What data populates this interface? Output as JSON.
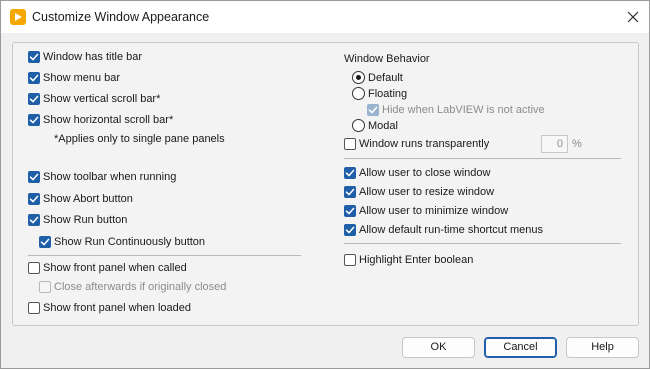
{
  "window": {
    "title": "Customize Window Appearance"
  },
  "left": {
    "title_bar": {
      "label": "Window has title bar",
      "checked": true
    },
    "menu_bar": {
      "label": "Show menu bar",
      "checked": true
    },
    "vscroll": {
      "label": "Show vertical scroll bar*",
      "checked": true
    },
    "hscroll": {
      "label": "Show horizontal scroll bar*",
      "checked": true
    },
    "note": "*Applies only to single pane panels",
    "toolbar": {
      "label": "Show toolbar when running",
      "checked": true
    },
    "abort": {
      "label": "Show Abort button",
      "checked": true
    },
    "run": {
      "label": "Show Run button",
      "checked": true
    },
    "run_cont": {
      "label": "Show Run Continuously button",
      "checked": true
    },
    "fp_called": {
      "label": "Show front panel when called",
      "checked": false
    },
    "close_after": {
      "label": "Close afterwards if originally closed",
      "checked": false
    },
    "fp_loaded": {
      "label": "Show front panel when loaded",
      "checked": false
    }
  },
  "right": {
    "behavior_label": "Window Behavior",
    "default": {
      "label": "Default",
      "selected": true
    },
    "floating": {
      "label": "Floating",
      "selected": false
    },
    "hide_active": {
      "label": "Hide when LabVIEW is not active",
      "checked": true
    },
    "modal": {
      "label": "Modal",
      "selected": false
    },
    "transparent": {
      "label": "Window runs transparently",
      "checked": false
    },
    "transparency_value": "0",
    "transparency_unit": "%",
    "allow_close": {
      "label": "Allow user to close window",
      "checked": true
    },
    "allow_resize": {
      "label": "Allow user to resize window",
      "checked": true
    },
    "allow_minimize": {
      "label": "Allow user to minimize window",
      "checked": true
    },
    "allow_shortcut": {
      "label": "Allow default run-time shortcut menus",
      "checked": true
    },
    "highlight_enter": {
      "label": "Highlight Enter boolean",
      "checked": false
    }
  },
  "buttons": {
    "ok": "OK",
    "cancel": "Cancel",
    "help": "Help"
  },
  "colors": {
    "accent": "#1f5fa8",
    "app_icon": "#f5a800"
  }
}
